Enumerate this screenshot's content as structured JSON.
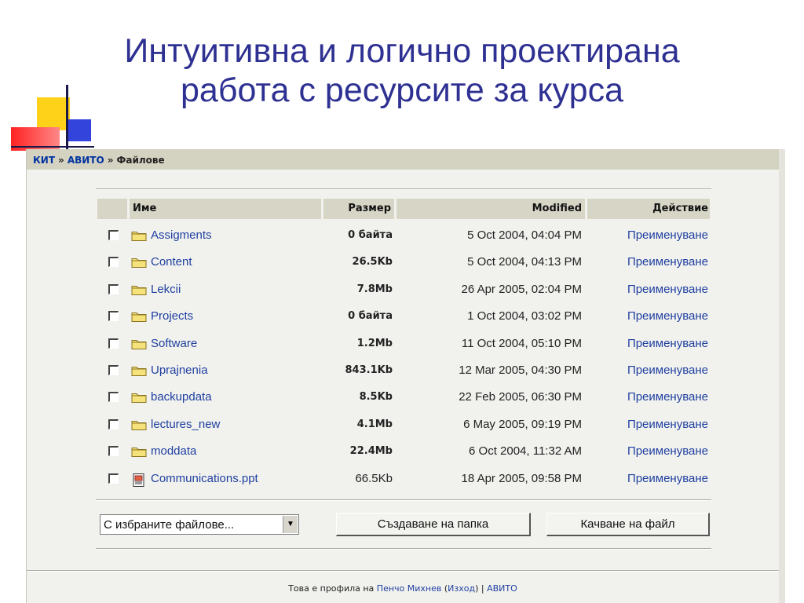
{
  "slide": {
    "title_line1": "Интуитивна и логично проектирана",
    "title_line2": "работа с ресурсите за курса"
  },
  "breadcrumb": {
    "item1": "КИТ",
    "item2": "АВИТО",
    "current": "Файлове",
    "separator": "»"
  },
  "table": {
    "headers": {
      "name": "Име",
      "size": "Размер",
      "modified": "Modified",
      "action": "Действие"
    },
    "rows": [
      {
        "name": "Assigments",
        "size": "0 байта",
        "modified": "5 Oct 2004, 04:04 PM",
        "action": "Преименуване",
        "icon": "folder-icon"
      },
      {
        "name": "Content",
        "size": "26.5Kb",
        "modified": "5 Oct 2004, 04:13 PM",
        "action": "Преименуване",
        "icon": "folder-icon"
      },
      {
        "name": "Lekcii",
        "size": "7.8Mb",
        "modified": "26 Apr 2005, 02:04 PM",
        "action": "Преименуване",
        "icon": "folder-icon"
      },
      {
        "name": "Projects",
        "size": "0 байта",
        "modified": "1 Oct 2004, 03:02 PM",
        "action": "Преименуване",
        "icon": "folder-icon"
      },
      {
        "name": "Software",
        "size": "1.2Mb",
        "modified": "11 Oct 2004, 05:10 PM",
        "action": "Преименуване",
        "icon": "folder-icon"
      },
      {
        "name": "Uprajnenia",
        "size": "843.1Kb",
        "modified": "12 Mar 2005, 04:30 PM",
        "action": "Преименуване",
        "icon": "folder-icon"
      },
      {
        "name": "backupdata",
        "size": "8.5Kb",
        "modified": "22 Feb 2005, 06:30 PM",
        "action": "Преименуване",
        "icon": "folder-icon"
      },
      {
        "name": "lectures_new",
        "size": "4.1Mb",
        "modified": "6 May 2005, 09:19 PM",
        "action": "Преименуване",
        "icon": "folder-icon"
      },
      {
        "name": "moddata",
        "size": "22.4Mb",
        "modified": "6 Oct 2004, 11:32 AM",
        "action": "Преименуване",
        "icon": "folder-icon"
      },
      {
        "name": "Communications.ppt",
        "size": "66.5Kb",
        "modified": "18 Apr 2005, 09:58 PM",
        "action": "Преименуване",
        "icon": "ppt-file-icon"
      }
    ]
  },
  "controls": {
    "select_value": "С избраните файлове...",
    "create_folder_label": "Създаване на папка",
    "upload_file_label": "Качване на файл"
  },
  "footer": {
    "prefix": "Това е профила на",
    "user": "Пенчо Михнев",
    "logout": "Изход",
    "course": "АВИТО"
  }
}
